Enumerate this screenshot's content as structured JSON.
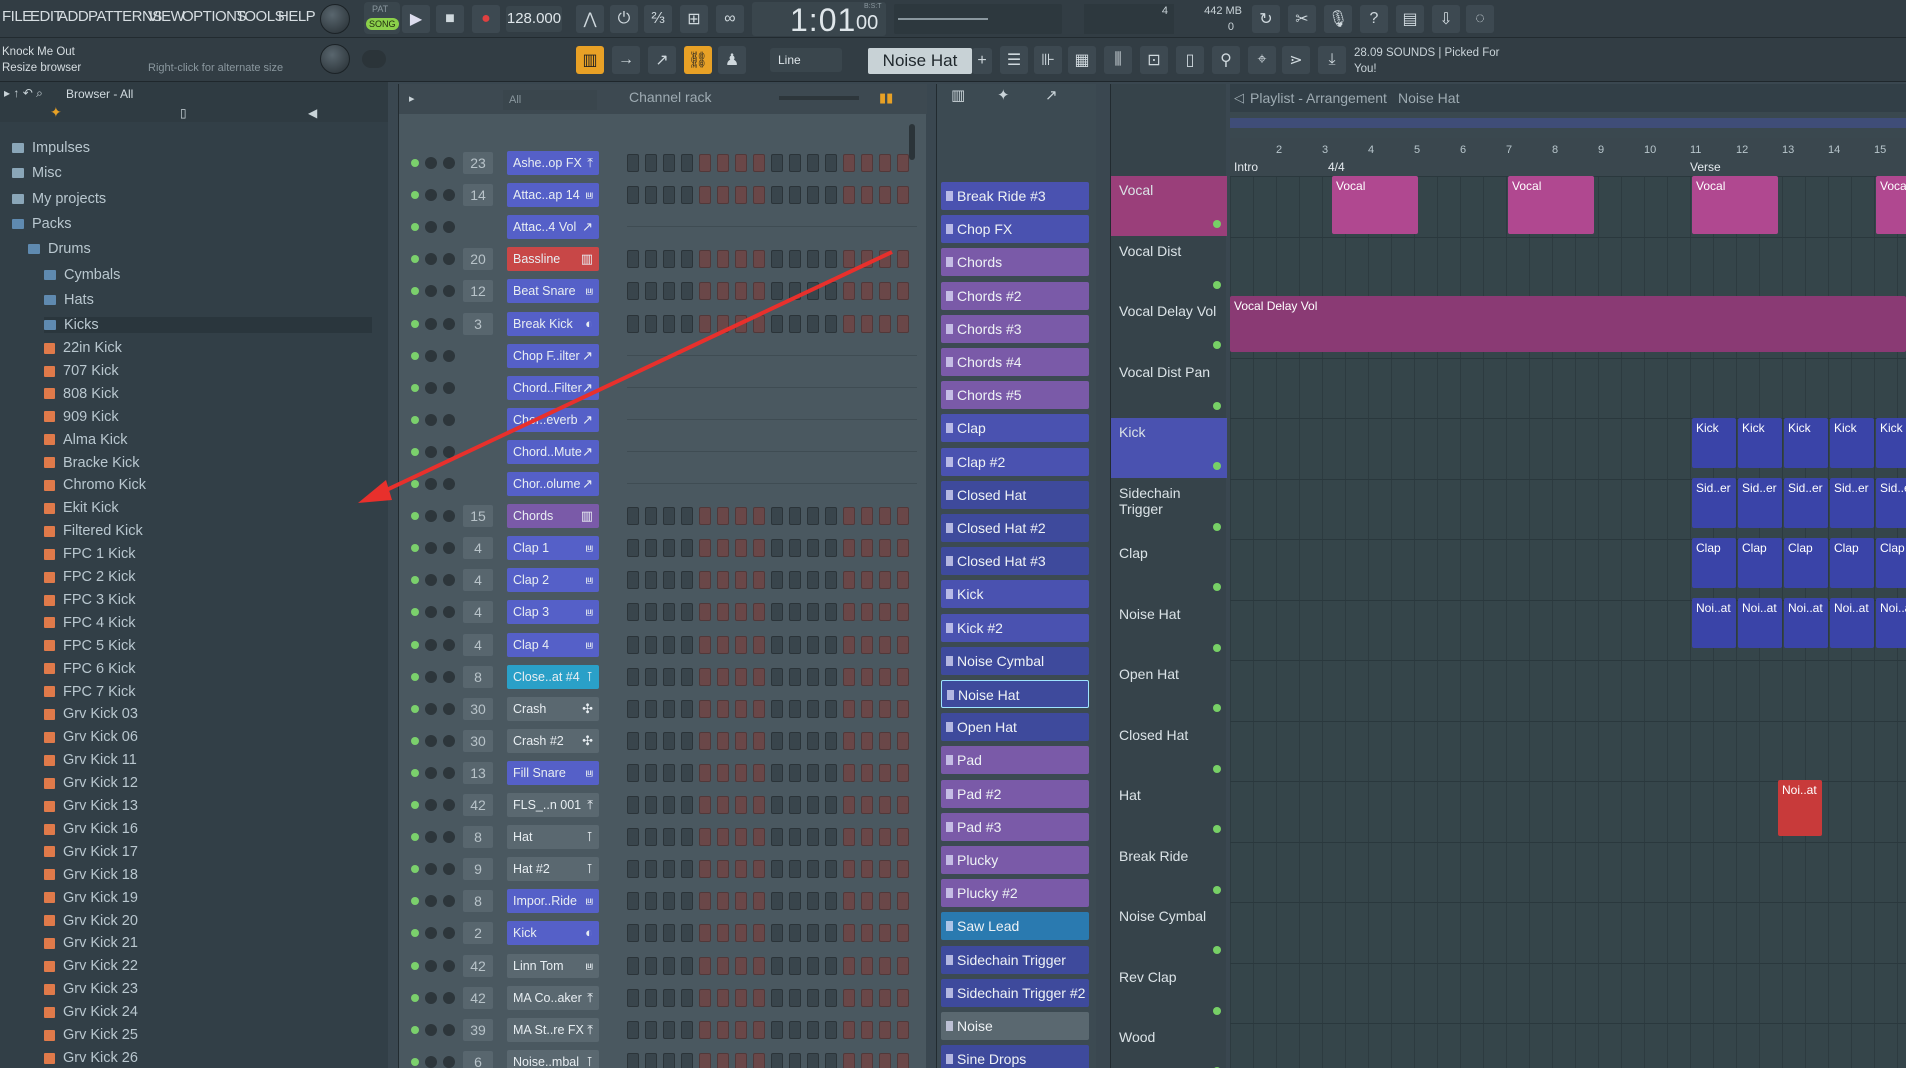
{
  "menu": [
    "FILE",
    "EDIT",
    "ADD",
    "PATTERNS",
    "VIEW",
    "OPTIONS",
    "TOOLS",
    "HELP"
  ],
  "transport": {
    "mode_pat": "PAT",
    "mode_song": "SONG",
    "tempo": "128.000",
    "time": "1:01",
    "time_sub": "00",
    "time_label": "B:S:T",
    "cpu_val": "4",
    "mem": "442 MB",
    "mem2": "0"
  },
  "hint": {
    "line1": "Knock Me Out",
    "line2": "Resize browser",
    "line3": "Right-click for alternate size"
  },
  "toolbar2": {
    "snap": "Line",
    "current_pattern": "Noise Hat",
    "news_line1": "28.09  SOUNDS | Picked For",
    "news_line2": "You!"
  },
  "browser": {
    "title": "Browser - All",
    "folders": [
      {
        "label": "Impulses",
        "type": "folder"
      },
      {
        "label": "Misc",
        "type": "folder"
      },
      {
        "label": "My projects",
        "type": "folder"
      },
      {
        "label": "Packs",
        "type": "folderopen"
      },
      {
        "label": "Drums",
        "type": "folderopen"
      },
      {
        "label": "Cymbals",
        "type": "folderopen"
      },
      {
        "label": "Hats",
        "type": "folderopen"
      },
      {
        "label": "Kicks",
        "type": "folderopen"
      }
    ],
    "kicks": [
      "22in Kick",
      "707 Kick",
      "808 Kick",
      "909 Kick",
      "Alma Kick",
      "Bracke Kick",
      "Chromo Kick",
      "Ekit Kick",
      "Filtered Kick",
      "FPC 1 Kick",
      "FPC 2 Kick",
      "FPC 3 Kick",
      "FPC 4 Kick",
      "FPC 5 Kick",
      "FPC 6 Kick",
      "FPC 7 Kick",
      "Grv Kick 03",
      "Grv Kick 06",
      "Grv Kick 11",
      "Grv Kick 12",
      "Grv Kick 13",
      "Grv Kick 16",
      "Grv Kick 17",
      "Grv Kick 18",
      "Grv Kick 19",
      "Grv Kick 20",
      "Grv Kick 21",
      "Grv Kick 22",
      "Grv Kick 23",
      "Grv Kick 24",
      "Grv Kick 25",
      "Grv Kick 26"
    ]
  },
  "channel_rack": {
    "title": "Channel rack",
    "filter": "All",
    "rows": [
      {
        "num": "23",
        "name": "Ashe..op FX",
        "color": "#5560c8",
        "icon": "⤒"
      },
      {
        "num": "14",
        "name": "Attac..ap 14",
        "color": "#5560c8",
        "icon": "⩏"
      },
      {
        "num": "",
        "name": "Attac..4 Vol",
        "color": "#5560c8",
        "icon": "↗"
      },
      {
        "num": "20",
        "name": "Bassline",
        "color": "#c84747",
        "icon": "▥"
      },
      {
        "num": "12",
        "name": "Beat Snare",
        "color": "#5560c8",
        "icon": "⩏"
      },
      {
        "num": "3",
        "name": "Break Kick",
        "color": "#5560c8",
        "icon": "◐"
      },
      {
        "num": "",
        "name": "Chop F..ilter",
        "color": "#5560c8",
        "icon": "↗"
      },
      {
        "num": "",
        "name": "Chord..Filter",
        "color": "#5560c8",
        "icon": "↗"
      },
      {
        "num": "",
        "name": "Chor..everb",
        "color": "#5560c8",
        "icon": "↗"
      },
      {
        "num": "",
        "name": "Chord..Mute",
        "color": "#5560c8",
        "icon": "↗"
      },
      {
        "num": "",
        "name": "Chor..olume",
        "color": "#5560c8",
        "icon": "↗"
      },
      {
        "num": "15",
        "name": "Chords",
        "color": "#7a5aa8",
        "icon": "▥"
      },
      {
        "num": "4",
        "name": "Clap 1",
        "color": "#5560c8",
        "icon": "⩏"
      },
      {
        "num": "4",
        "name": "Clap 2",
        "color": "#5560c8",
        "icon": "⩏"
      },
      {
        "num": "4",
        "name": "Clap 3",
        "color": "#5560c8",
        "icon": "⩏"
      },
      {
        "num": "4",
        "name": "Clap 4",
        "color": "#5560c8",
        "icon": "⩏"
      },
      {
        "num": "8",
        "name": "Close..at #4",
        "color": "#2aa0c8",
        "icon": "⊺"
      },
      {
        "num": "30",
        "name": "Crash",
        "color": "#5a6870",
        "icon": "✣"
      },
      {
        "num": "30",
        "name": "Crash #2",
        "color": "#5a6870",
        "icon": "✣"
      },
      {
        "num": "13",
        "name": "Fill Snare",
        "color": "#5560c8",
        "icon": "⩏"
      },
      {
        "num": "42",
        "name": "FLS_..n 001",
        "color": "#5a6870",
        "icon": "⤒"
      },
      {
        "num": "8",
        "name": "Hat",
        "color": "#5a6870",
        "icon": "⊺"
      },
      {
        "num": "9",
        "name": "Hat #2",
        "color": "#5a6870",
        "icon": "⊺"
      },
      {
        "num": "8",
        "name": "Impor..Ride",
        "color": "#5560c8",
        "icon": "⩏"
      },
      {
        "num": "2",
        "name": "Kick",
        "color": "#5560c8",
        "icon": "◐"
      },
      {
        "num": "42",
        "name": "Linn Tom",
        "color": "#5a6870",
        "icon": "⩏"
      },
      {
        "num": "42",
        "name": "MA Co..aker",
        "color": "#5a6870",
        "icon": "⤒"
      },
      {
        "num": "39",
        "name": "MA St..re FX",
        "color": "#5a6870",
        "icon": "⤒"
      },
      {
        "num": "6",
        "name": "Noise..mbal",
        "color": "#5a6870",
        "icon": "⊺"
      }
    ]
  },
  "patterns": [
    {
      "name": "Break Ride #3",
      "color": "#4a52b0"
    },
    {
      "name": "Chop FX",
      "color": "#4a52b0"
    },
    {
      "name": "Chords",
      "color": "#7a5aa8"
    },
    {
      "name": "Chords #2",
      "color": "#7a5aa8"
    },
    {
      "name": "Chords #3",
      "color": "#7a5aa8"
    },
    {
      "name": "Chords #4",
      "color": "#7a5aa8"
    },
    {
      "name": "Chords #5",
      "color": "#7a5aa8"
    },
    {
      "name": "Clap",
      "color": "#4a52b0"
    },
    {
      "name": "Clap #2",
      "color": "#4a52b0"
    },
    {
      "name": "Closed Hat",
      "color": "#3e4a9c"
    },
    {
      "name": "Closed Hat #2",
      "color": "#3e4a9c"
    },
    {
      "name": "Closed Hat #3",
      "color": "#3e4a9c"
    },
    {
      "name": "Kick",
      "color": "#4a52b0"
    },
    {
      "name": "Kick #2",
      "color": "#4a52b0"
    },
    {
      "name": "Noise Cymbal",
      "color": "#3e4a9c"
    },
    {
      "name": "Noise Hat",
      "color": "#3e4a9c",
      "sel": true
    },
    {
      "name": "Open Hat",
      "color": "#3e4a9c"
    },
    {
      "name": "Pad",
      "color": "#7a5aa8"
    },
    {
      "name": "Pad #2",
      "color": "#7a5aa8"
    },
    {
      "name": "Pad #3",
      "color": "#7a5aa8"
    },
    {
      "name": "Plucky",
      "color": "#7a5aa8"
    },
    {
      "name": "Plucky #2",
      "color": "#7a5aa8"
    },
    {
      "name": "Saw Lead",
      "color": "#2a7ab0"
    },
    {
      "name": "Sidechain Trigger",
      "color": "#3e4a9c"
    },
    {
      "name": "Sidechain Trigger #2",
      "color": "#3e4a9c"
    },
    {
      "name": "Noise",
      "color": "#5a6870"
    },
    {
      "name": "Sine Drops",
      "color": "#3e4a9c"
    }
  ],
  "playlist": {
    "title": "Playlist - Arrangement",
    "crumb": "Noise Hat",
    "sig": "4/4",
    "markers": [
      {
        "label": "Intro"
      },
      {
        "label": "Verse"
      }
    ],
    "bars": [
      "2",
      "3",
      "4",
      "5",
      "6",
      "7",
      "8",
      "9",
      "10",
      "11",
      "12",
      "13",
      "14",
      "15"
    ],
    "tracks": [
      {
        "name": "Vocal",
        "hl": "#9a3f7a"
      },
      {
        "name": "Vocal Dist"
      },
      {
        "name": "Vocal Delay Vol"
      },
      {
        "name": "Vocal Dist Pan"
      },
      {
        "name": "Kick",
        "hl": "#4a52b0"
      },
      {
        "name": "Sidechain Trigger"
      },
      {
        "name": "Clap"
      },
      {
        "name": "Noise Hat"
      },
      {
        "name": "Open Hat"
      },
      {
        "name": "Closed Hat"
      },
      {
        "name": "Hat"
      },
      {
        "name": "Break Ride"
      },
      {
        "name": "Noise Cymbal"
      },
      {
        "name": "Rev Clap"
      },
      {
        "name": "Wood"
      }
    ],
    "clips": {
      "vocal": "Vocal",
      "delay": "Vocal Delay Vol",
      "kick": "Kick",
      "side": "Sid..er",
      "clap": "Clap",
      "noise": "Noi..at",
      "red": "Noi..at"
    }
  }
}
